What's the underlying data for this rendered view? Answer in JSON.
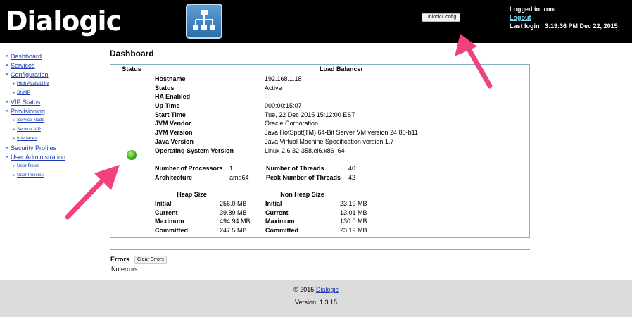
{
  "header": {
    "logo_text": "Dialogic",
    "unlock_label": "Unlock Config",
    "logged_in_label": "Logged in:",
    "user": "root",
    "logout_label": "Logout",
    "last_login_label": "Last login",
    "last_login_value": "3:19:36 PM Dec 22, 2015"
  },
  "sidebar": {
    "items": [
      {
        "label": "Dashboard",
        "level": 0
      },
      {
        "label": "Services",
        "level": 0
      },
      {
        "label": "Configuration",
        "level": 0
      },
      {
        "label": "High Availability",
        "level": 1
      },
      {
        "label": "SNMP",
        "level": 1
      },
      {
        "label": "VIP Status",
        "level": 0
      },
      {
        "label": "Provisioning",
        "level": 0
      },
      {
        "label": "Service Node",
        "level": 1
      },
      {
        "label": "Service VIP",
        "level": 1
      },
      {
        "label": "Interfaces",
        "level": 1
      },
      {
        "label": "Security Profiles",
        "level": 0
      },
      {
        "label": "User Administration",
        "level": 0
      },
      {
        "label": "User Roles",
        "level": 1
      },
      {
        "label": "User Policies",
        "level": 1
      }
    ]
  },
  "main": {
    "title": "Dashboard",
    "status_header": "Status",
    "lb_header": "Load Balancer",
    "status_color": "#3ea81d",
    "info": [
      {
        "k": "Hostname",
        "v": "192.168.1.18"
      },
      {
        "k": "Status",
        "v": "Active"
      },
      {
        "k": "HA Enabled",
        "v": ""
      },
      {
        "k": "Up Time",
        "v": "000:00:15:07"
      },
      {
        "k": "Start Time",
        "v": "Tue, 22 Dec 2015 15:12:00 EST"
      },
      {
        "k": "JVM Vendor",
        "v": "Oracle Corporation"
      },
      {
        "k": "JVM Version",
        "v": "Java HotSpot(TM) 64-Bit Server VM version 24.80-b11"
      },
      {
        "k": "Java Version",
        "v": "Java Virtual Machine Specification version 1.7"
      },
      {
        "k": "Operating System Version",
        "v": "Linux 2.6.32-358.el6.x86_64"
      }
    ],
    "proc": [
      {
        "k1": "Number of Processors",
        "v1": "1",
        "k2": "Number of Threads",
        "v2": "40"
      },
      {
        "k1": "Architecture",
        "v1": "amd64",
        "k2": "Peak Number of Threads",
        "v2": "42"
      }
    ],
    "heap_title": "Heap Size",
    "nonheap_title": "Non Heap Size",
    "heap": [
      {
        "k1": "Initial",
        "v1": "256.0 MB",
        "k2": "Initial",
        "v2": "23.19 MB"
      },
      {
        "k1": "Current",
        "v1": "39.89 MB",
        "k2": "Current",
        "v2": "13.01 MB"
      },
      {
        "k1": "Maximum",
        "v1": "494.94 MB",
        "k2": "Maximum",
        "v2": "130.0 MB"
      },
      {
        "k1": "Committed",
        "v1": "247.5 MB",
        "k2": "Committed",
        "v2": "23.19 MB"
      }
    ]
  },
  "errors": {
    "title": "Errors",
    "clear_label": "Clear Errors",
    "text": "No errors"
  },
  "footer": {
    "copyright": "© 2015",
    "link": "Dialogic",
    "version_label": "Version:",
    "version": "1.3.15"
  },
  "annotations": {
    "arrow_color": "#f0427f"
  }
}
